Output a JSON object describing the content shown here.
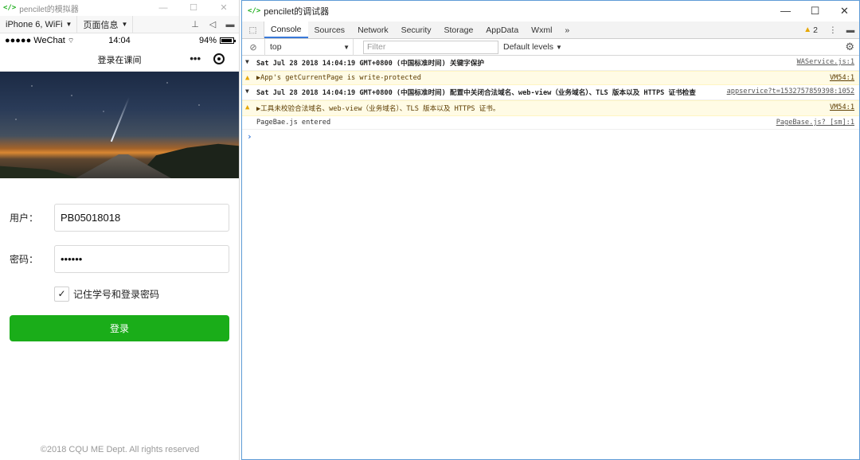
{
  "simulator": {
    "title": "pencilet的模拟器",
    "device": "iPhone 6, WiFi",
    "page_info": "页面信息",
    "status": {
      "signal": "●●●●● WeChat",
      "time": "14:04",
      "battery": "94%"
    },
    "nav_title": "登录在课间",
    "nav_more": "•••",
    "form": {
      "user_label": "用户：",
      "user_value": "PB05018018",
      "pwd_label": "密码：",
      "pwd_value": "••••••",
      "remember_label": "记住学号和登录密码",
      "remember_checked": true,
      "login_label": "登录"
    },
    "footer": "©2018 CQU ME Dept. All rights reserved",
    "accent": "#1aad19"
  },
  "debugger": {
    "title": "pencilet的调试器",
    "tabs": [
      "Console",
      "Sources",
      "Network",
      "Security",
      "Storage",
      "AppData",
      "Wxml"
    ],
    "more_tabs": "»",
    "active_tab": "Console",
    "warning_count": "2",
    "context": "top",
    "filter_placeholder": "Filter",
    "levels": "Default levels",
    "messages": [
      {
        "type": "group",
        "text": "Sat Jul 28 2018 14:04:19 GMT+0800 (中国标准时间) 关键字保护",
        "source": "WAService.js:1"
      },
      {
        "type": "warn",
        "text": "▶App's getCurrentPage is write-protected",
        "source": "VM54:1"
      },
      {
        "type": "group",
        "text": "Sat Jul 28 2018 14:04:19 GMT+0800 (中国标准时间) 配置中关闭合法域名、web-view（业务域名）、TLS 版本以及 HTTPS 证书检查",
        "source": "appservice?t=1532757859398:1052"
      },
      {
        "type": "warn",
        "text": "▶工具未校验合法域名、web-view（业务域名）、TLS 版本以及 HTTPS 证书。",
        "source": "VM54:1"
      },
      {
        "type": "plain",
        "text": "PageBae.js entered",
        "source": "PageBase.js? [sm]:1"
      }
    ]
  }
}
